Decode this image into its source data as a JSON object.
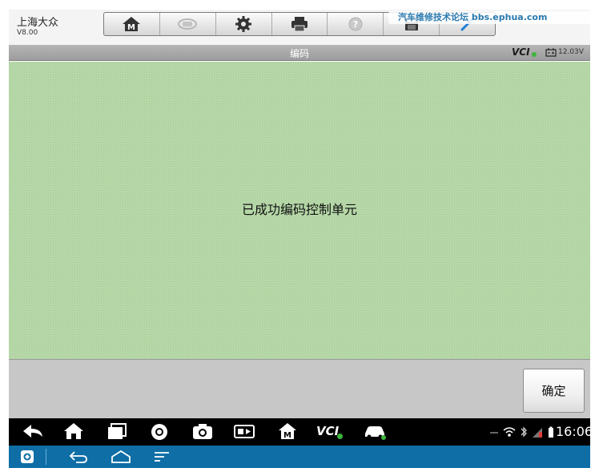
{
  "header": {
    "app_title": "上海大众",
    "version": "V8.00",
    "toolbar": [
      {
        "name": "home-m-icon"
      },
      {
        "name": "vehicle-swap-icon"
      },
      {
        "name": "gear-icon"
      },
      {
        "name": "printer-icon"
      },
      {
        "name": "help-icon"
      },
      {
        "name": "save-icon"
      },
      {
        "name": "pen-icon"
      }
    ]
  },
  "titlebar": {
    "title": "编码",
    "vci_label": "VCI",
    "voltage": "12.03V"
  },
  "content": {
    "message": "已成功编码控制单元"
  },
  "footer": {
    "ok_label": "确定"
  },
  "android": {
    "clock": "16:06",
    "vci_label": "VCI"
  },
  "watermark": "汽车维修技术论坛 bbs.ephua.com",
  "colors": {
    "content_bg": "#b6d8a8",
    "nav_blue": "#0f6ea6",
    "vci_green": "#3db53d"
  }
}
